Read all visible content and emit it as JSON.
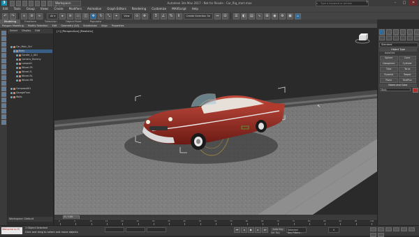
{
  "titlebar": {
    "app_badge": "3",
    "workspace": "Workspace: Default",
    "window_title": "Autodesk 3ds Max 2017 - Not for Resale - Car_Rig_start.max",
    "search_placeholder": "Type a keyword or phrase",
    "help": "?",
    "minimize": "–",
    "maximize": "□",
    "close": "✕"
  },
  "menubar": {
    "items": [
      "Edit",
      "Tools",
      "Group",
      "Views",
      "Create",
      "Modifiers",
      "Animation",
      "Graph Editors",
      "Rendering",
      "Customize",
      "MAXScript",
      "Help"
    ]
  },
  "toolbar": {
    "view_dropdown": "View",
    "selection_set_dropdown": "Create Selection Se"
  },
  "ribbon": {
    "tabs": [
      "Modeling",
      "Freeform",
      "Selection",
      "Object Paint",
      "Populate"
    ],
    "sub_items": [
      "Polygon Modeling",
      "Modify Selection",
      "Edit",
      "Geometry (All)",
      "Subdivision",
      "Align",
      "Properties"
    ]
  },
  "scene_explorer": {
    "tabs": [
      "Select",
      "Display",
      "Edit"
    ],
    "rows": [
      {
        "label": "Car_Main_Ctrl",
        "indent": 1,
        "selected": false
      },
      {
        "label": "Body",
        "indent": 2,
        "selected": true
      },
      {
        "label": "Candle_1_001",
        "indent": 3,
        "selected": false
      },
      {
        "label": "Camera_Dummy",
        "indent": 3,
        "selected": false
      },
      {
        "label": "Lamps01",
        "indent": 3,
        "selected": false
      },
      {
        "label": "Wheel-FR",
        "indent": 3,
        "selected": false
      },
      {
        "label": "Wheel-FL",
        "indent": 3,
        "selected": false
      },
      {
        "label": "Wheel-RL",
        "indent": 3,
        "selected": false
      },
      {
        "label": "Wheel-RR",
        "indent": 3,
        "selected": false
      },
      {
        "label": "Compass001",
        "indent": 1,
        "selected": false
      },
      {
        "label": "GarageFloor",
        "indent": 1,
        "selected": false
      },
      {
        "label": "Walls",
        "indent": 1,
        "selected": false
      }
    ],
    "workspace_footer": "Workspace: Default"
  },
  "viewport": {
    "label": "[+] [Perspective] [Realistic]"
  },
  "command_panel": {
    "dropdown": "Standard",
    "object_type_header": "Object Type",
    "autogrid": "AutoGrid",
    "objects": [
      "Sphere",
      "Cone",
      "Geosphere",
      "Cylinder",
      "Tube",
      "Torus",
      "Pyramid",
      "Teapot",
      "Plane",
      "TextPlus"
    ],
    "name_color_header": "Name and Color",
    "name_value": "Body",
    "swatch_color": "#b0322c"
  },
  "timeline": {
    "slider_label": "0 / 100",
    "ticks": [
      "0",
      "5",
      "10",
      "15",
      "20",
      "25",
      "30",
      "35",
      "40",
      "45",
      "50",
      "55",
      "60",
      "65",
      "70",
      "75",
      "80",
      "85",
      "90",
      "95",
      "100"
    ]
  },
  "statusbar": {
    "maxscript": "Welcome to M",
    "status_line1": "1 Object Selected",
    "status_line2": "Click and drag to select and move objects",
    "auto_key": "Auto Key",
    "selected": "Selected",
    "set_key": "Set Key",
    "key_filters": "Key Filters...",
    "frame": "0"
  }
}
